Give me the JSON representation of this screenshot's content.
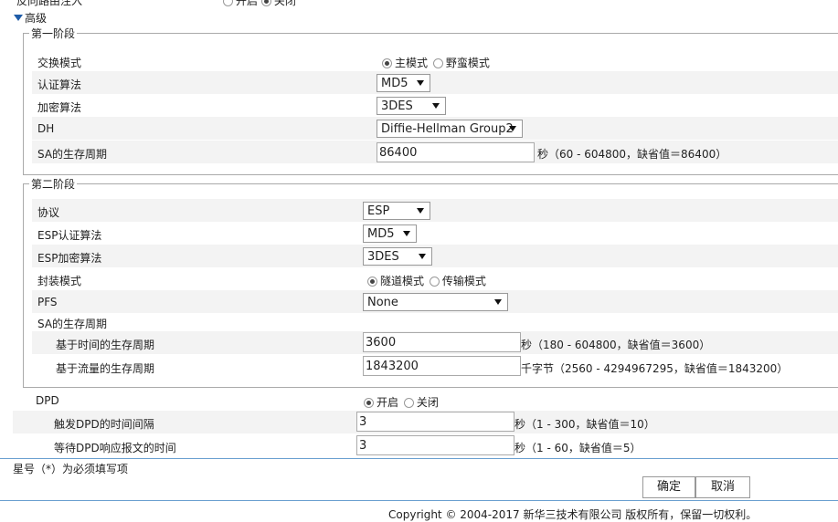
{
  "top_row": {
    "label": "反向路由注入",
    "on": "开启",
    "off": "关闭"
  },
  "advanced": {
    "label": "高级"
  },
  "phase1": {
    "title": "第一阶段",
    "exchange_mode": {
      "label": "交换模式",
      "opt1": "主模式",
      "opt2": "野蛮模式"
    },
    "auth": {
      "label": "认证算法",
      "value": "MD5"
    },
    "enc": {
      "label": "加密算法",
      "value": "3DES"
    },
    "dh": {
      "label": "DH",
      "value": "Diffie-Hellman Group2"
    },
    "sa": {
      "label": "SA的生存周期",
      "value": "86400",
      "hint": "秒（60 - 604800，缺省值＝86400）"
    }
  },
  "phase2": {
    "title": "第二阶段",
    "protocol": {
      "label": "协议",
      "value": "ESP"
    },
    "esp_auth": {
      "label": "ESP认证算法",
      "value": "MD5"
    },
    "esp_enc": {
      "label": "ESP加密算法",
      "value": "3DES"
    },
    "encap": {
      "label": "封装模式",
      "opt1": "隧道模式",
      "opt2": "传输模式"
    },
    "pfs": {
      "label": "PFS",
      "value": "None"
    },
    "sa_label": "SA的生存周期",
    "sa_time": {
      "label": "基于时间的生存周期",
      "value": "3600",
      "hint": "秒（180 - 604800，缺省值＝3600）"
    },
    "sa_traffic": {
      "label": "基于流量的生存周期",
      "value": "1843200",
      "hint": "千字节（2560 - 4294967295，缺省值＝1843200）"
    }
  },
  "dpd": {
    "label": "DPD",
    "on": "开启",
    "off": "关闭",
    "interval": {
      "label": "触发DPD的时间间隔",
      "value": "3",
      "hint": "秒（1 - 300，缺省值＝10）"
    },
    "timeout": {
      "label": "等待DPD响应报文的时间",
      "value": "3",
      "hint": "秒（1 - 60，缺省值＝5）"
    }
  },
  "note": "星号（*）为必须填写项",
  "buttons": {
    "ok": "确定",
    "cancel": "取消"
  },
  "footer": "Copyright © 2004-2017 新华三技术有限公司 版权所有，保留一切权利。"
}
